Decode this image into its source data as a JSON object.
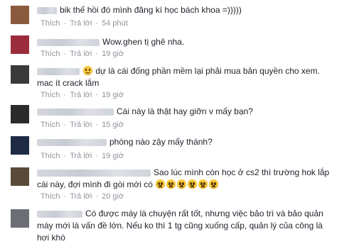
{
  "actions": {
    "like": "Thích",
    "reply": "Trả lời",
    "separator": "·"
  },
  "comments": [
    {
      "text": "bik thế hồi đó mình đăng kí học bách khoa =)))))",
      "time": "54 phút",
      "avatar_color": "#8b5a3c"
    },
    {
      "text": "Wow.ghen tị ghê nha.",
      "time": "19 giờ",
      "avatar_color": "#9b2c3c"
    },
    {
      "text_prefix": "",
      "text": "dự là cái đống phần mềm lại phải mua bản quyền cho xem.",
      "text2": "mac ít crack lắm",
      "emoji": "hmm",
      "time": "19 giờ",
      "avatar_color": "#3a3a3a"
    },
    {
      "text": "Cái này là thật hay giỡn v mấy bạn?",
      "time": "15 giờ",
      "avatar_color": "#2b2b2b"
    },
    {
      "text": "phòng nào zậy mấy thánh?",
      "time": "19 giờ",
      "avatar_color": "#1f2a44"
    },
    {
      "text": "Sao lúc mình còn học ở cs2 thì trường hok lắp",
      "text2": "cái này, đợi mình đi gòi mới có",
      "emoji_count": 6,
      "time": "20 giờ",
      "avatar_color": "#5a4a3a"
    },
    {
      "text": "Có được máy là chuyện rất tốt, nhưng việc bảo trì và bảo quản",
      "text2": "máy mới là vấn đề lớn. Nếu ko thì 1 tg cũng xuống cấp, quản lý của công là",
      "text3": "hơi khó",
      "avatar_color": "#6b6e75"
    }
  ]
}
